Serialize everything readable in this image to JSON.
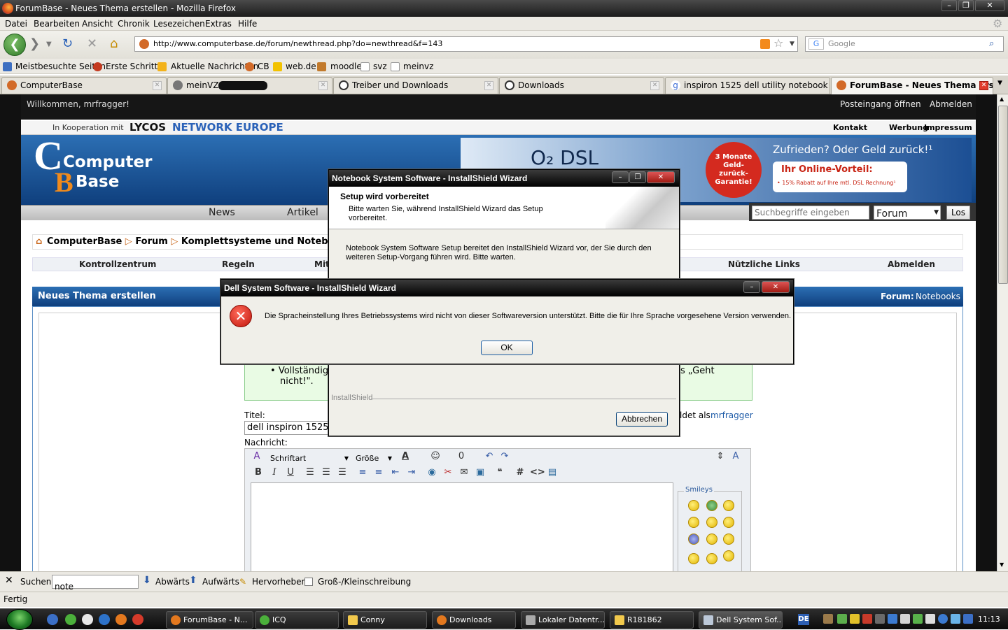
{
  "window": {
    "title": "ForumBase - Neues Thema erstellen - Mozilla Firefox"
  },
  "menu": [
    "Datei",
    "Bearbeiten",
    "Ansicht",
    "Chronik",
    "Lesezeichen",
    "Extras",
    "Hilfe"
  ],
  "address": {
    "url": "http://www.computerbase.de/forum/newthread.php?do=newthread&f=143",
    "search_placeholder": "Google"
  },
  "bookmarks": [
    "Meistbesuchte Seiten",
    "Erste Schritte",
    "Aktuelle Nachrichten",
    "CB",
    "web.de",
    "moodle",
    "svz",
    "meinvz"
  ],
  "tabs": [
    {
      "label": "ComputerBase",
      "icon": "cb-icon",
      "active": false
    },
    {
      "label": "meinVZ |",
      "icon": "gear-icon",
      "active": false
    },
    {
      "label": "Treiber und Downloads",
      "icon": "dell-icon",
      "active": false
    },
    {
      "label": "Downloads",
      "icon": "dell-icon",
      "active": false
    },
    {
      "label": "inspiron 1525 dell utility notebook sy...",
      "icon": "google-icon",
      "active": false
    },
    {
      "label": "ForumBase - Neues Thema ers...",
      "icon": "cb-icon",
      "active": true
    }
  ],
  "page": {
    "welcome": "Willkommen, mrfragger!",
    "inbox": "Posteingang öffnen",
    "logout": "Abmelden",
    "coop": "In Kooperation mit",
    "lycos": "LYCOS",
    "network": "NETWORK EUROPE",
    "toplinks": [
      "Kontakt",
      "Werbung",
      "Impressum"
    ],
    "logo_line1": "Computer",
    "logo_line2": "Base",
    "ad": {
      "brand": "O₂ DSL",
      "badge": "3 Monate Geld-zurück-Garantie!",
      "headline": "Zufrieden? Oder Geld zurück!¹",
      "offer": "Ihr Online-Vorteil:",
      "sub": "• 15% Rabatt auf Ihre mtl. DSL Rechnung¹"
    },
    "nav": [
      "News",
      "Artikel"
    ],
    "search": {
      "placeholder": "Suchbegriffe eingeben",
      "scope": "Forum",
      "button": "Los"
    },
    "breadcrumb": [
      "ComputerBase",
      "Forum",
      "Komplettsysteme und Notebooks"
    ],
    "menu3": [
      "Kontrollzentrum",
      "Regeln",
      "Mit",
      "Nützliche Links",
      "Abmelden"
    ],
    "panel": {
      "title": "Neues Thema erstellen",
      "forum_label": "Forum:",
      "forum_value": "Notebooks"
    },
    "notice": {
      "line1": "Vollständig",
      "line2": "nicht!\".",
      "tail": "s „Geht"
    },
    "title_label": "Titel:",
    "title_value": "dell inspiron 1525",
    "logged_as": "ldet als",
    "username": "mrfragger",
    "message_label": "Nachricht:",
    "editor": {
      "font": "Schriftart",
      "size": "Größe"
    },
    "smileys_label": "Smileys"
  },
  "dialog_back": {
    "title": "Notebook System Software - InstallShield Wizard",
    "heading": "Setup wird vorbereitet",
    "sub": "Bitte warten Sie, während InstallShield Wizard das Setup vorbereitet.",
    "body": "Notebook System Software Setup bereitet den InstallShield Wizard vor, der Sie durch den weiteren Setup-Vorgang führen wird. Bitte warten.",
    "brand": "InstallShield",
    "cancel": "Abbrechen"
  },
  "dialog_front": {
    "title": "Dell System Software - InstallShield Wizard",
    "message": "Die Spracheinstellung Ihres Betriebssystems wird nicht von dieser Softwareversion unterstützt. Bitte die für Ihre Sprache vorgesehene Version verwenden.",
    "ok": "OK"
  },
  "findbar": {
    "label": "Suchen:",
    "value": "note",
    "down": "Abwärts",
    "up": "Aufwärts",
    "highlight": "Hervorheben",
    "case": "Groß-/Kleinschreibung"
  },
  "status": "Fertig",
  "taskbar": {
    "items": [
      {
        "label": "ForumBase - N...",
        "active": false
      },
      {
        "label": "ICQ",
        "active": false
      },
      {
        "label": "Conny",
        "active": false
      },
      {
        "label": "Downloads",
        "active": false
      },
      {
        "label": "Lokaler Datentr...",
        "active": false
      },
      {
        "label": "R181862",
        "active": false
      },
      {
        "label": "Dell System Sof...",
        "active": true
      }
    ],
    "lang": "DE",
    "clock": "11:13"
  }
}
